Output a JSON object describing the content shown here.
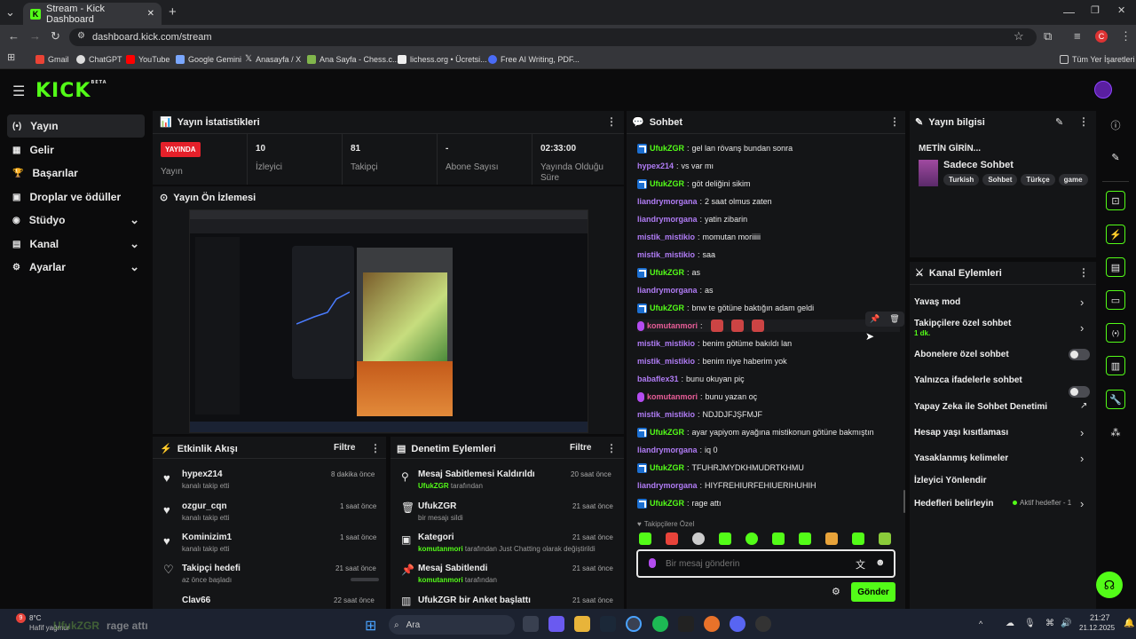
{
  "browser": {
    "tab_title": "Stream - Kick Dashboard",
    "url": "dashboard.kick.com/stream",
    "profile_initial": "C",
    "bookmarks": [
      "Gmail",
      "ChatGPT",
      "YouTube",
      "Google Gemini",
      "Anasayfa / X",
      "Ana Sayfa - Chess.c...",
      "lichess.org • Ücretsi...",
      "Free AI Writing, PDF..."
    ],
    "all_bookmarks": "Tüm Yer İşaretleri"
  },
  "app": {
    "logo": "KICK",
    "logo_sup": "BETA"
  },
  "nav": [
    {
      "label": "Yayın",
      "icon": "(•)"
    },
    {
      "label": "Gelir",
      "icon": "▦"
    },
    {
      "label": "Başarılar",
      "icon": "🏆"
    },
    {
      "label": "Droplar ve ödüller",
      "icon": "▣"
    },
    {
      "label": "Stüdyo",
      "icon": "◉"
    },
    {
      "label": "Kanal",
      "icon": "▤"
    },
    {
      "label": "Ayarlar",
      "icon": "⚙"
    }
  ],
  "stats": {
    "title": "Yayın İstatistikleri",
    "live_badge": "YAYINDA",
    "live_label": "Yayın",
    "items": [
      {
        "value": "10",
        "label": "İzleyici"
      },
      {
        "value": "81",
        "label": "Takipçi"
      },
      {
        "value": "-",
        "label": "Abone Sayısı"
      },
      {
        "value": "02:33:00",
        "label": "Yayında Olduğu Süre"
      }
    ]
  },
  "preview": {
    "title": "Yayın Ön İzlemesi"
  },
  "activity": {
    "title": "Etkinlik Akışı",
    "filter": "Filtre",
    "items": [
      {
        "name": "hypex214",
        "sub": "kanalı takip etti",
        "time": "8 dakika önce"
      },
      {
        "name": "ozgur_cqn",
        "sub": "kanalı takip etti",
        "time": "1 saat önce"
      },
      {
        "name": "Kominizim1",
        "sub": "kanalı takip etti",
        "time": "1 saat önce"
      },
      {
        "name": "Takipçi hedefi",
        "sub": "az önce başladı",
        "time": "21 saat önce"
      },
      {
        "name": "Clav66",
        "sub": "",
        "time": "22 saat önce"
      }
    ]
  },
  "moderation": {
    "title": "Denetim Eylemleri",
    "filter": "Filtre",
    "items": [
      {
        "title": "Mesaj Sabitlemesi Kaldırıldı",
        "user": "UfukZGR",
        "rest": "tarafından",
        "time": "20 saat önce"
      },
      {
        "title": "UfukZGR",
        "user": "",
        "rest": "bir mesajı sildi",
        "time": "21 saat önce"
      },
      {
        "title": "Kategori",
        "user": "komutanmori",
        "rest": "tarafından Just Chatting olarak değiştirildi",
        "time": "21 saat önce"
      },
      {
        "title": "Mesaj Sabitlendi",
        "user": "komutanmori",
        "rest": "tarafından",
        "time": "21 saat önce"
      },
      {
        "title": "UfukZGR bir Anket başlattı",
        "user": "",
        "rest": "",
        "time": "21 saat önce"
      }
    ]
  },
  "chat": {
    "title": "Sohbet",
    "followers_only": "Takipçilere Özel",
    "placeholder": "Bir mesaj gönderin",
    "send": "Gönder",
    "messages": [
      {
        "user": "UfukZGR",
        "color": "green",
        "badge": true,
        "text": "gel lan rövanş bundan sonra"
      },
      {
        "user": "hypex214",
        "color": "purple",
        "text": "vs var mı"
      },
      {
        "user": "UfukZGR",
        "color": "green",
        "badge": true,
        "text": "göt deliğini sikim"
      },
      {
        "user": "liandrymorgana",
        "color": "purple",
        "text": "2 saat olmus zaten"
      },
      {
        "user": "liandrymorgana",
        "color": "purple",
        "text": "yatin zibarin"
      },
      {
        "user": "mistik_mistikio",
        "color": "purple",
        "text": "momutan moriiiii"
      },
      {
        "user": "mistik_mistikio",
        "color": "purple",
        "text": "saa"
      },
      {
        "user": "UfukZGR",
        "color": "green",
        "badge": true,
        "text": "as"
      },
      {
        "user": "liandrymorgana",
        "color": "purple",
        "text": "as"
      },
      {
        "user": "UfukZGR",
        "color": "green",
        "badge": true,
        "text": "bnw te götüne baktığın adam geldi"
      },
      {
        "user": "komutanmori",
        "color": "pink",
        "mic": true,
        "text": ""
      },
      {
        "user": "mistik_mistikio",
        "color": "purple",
        "text": "benim götüme bakıldı lan"
      },
      {
        "user": "mistik_mistikio",
        "color": "purple",
        "text": "benim niye haberim yok"
      },
      {
        "user": "babaflex31",
        "color": "purple",
        "text": "bunu okuyan piç"
      },
      {
        "user": "komutanmori",
        "color": "pink",
        "mic": true,
        "text": "bunu yazan oç"
      },
      {
        "user": "mistik_mistikio",
        "color": "purple",
        "text": "NDJDJFJŞFMJF"
      },
      {
        "user": "UfukZGR",
        "color": "green",
        "badge": true,
        "text": "ayar yapiyom ayağına mistikonun götüne bakmıştın"
      },
      {
        "user": "liandrymorgana",
        "color": "purple",
        "text": "iq 0"
      },
      {
        "user": "UfukZGR",
        "color": "green",
        "badge": true,
        "text": "TFUHRJMYDKHMUDRTKHMU"
      },
      {
        "user": "liandrymorgana",
        "color": "purple",
        "text": "HIYFREHIURFEHIUERIHUHIH"
      },
      {
        "user": "UfukZGR",
        "color": "green",
        "badge": true,
        "text": "rage attı"
      }
    ]
  },
  "info": {
    "title": "Yayın bilgisi",
    "stream_title": "METİN GİRİN...",
    "category": "Sadece Sohbet",
    "tags": [
      "Turkish",
      "Sohbet",
      "Türkçe",
      "game"
    ]
  },
  "actions": {
    "title": "Kanal Eylemleri",
    "items": [
      {
        "label": "Yavaş mod",
        "sub": "",
        "type": "chevron"
      },
      {
        "label": "Takipçilere özel sohbet",
        "sub": "1 dk.",
        "type": "chevron"
      },
      {
        "label": "Abonelere özel sohbet",
        "sub": "",
        "type": "toggle"
      },
      {
        "label": "Yalnızca ifadelerle sohbet",
        "sub": "",
        "type": "toggle"
      },
      {
        "label": "Yapay Zeka ile Sohbet Denetimi",
        "sub": "",
        "type": "ext"
      },
      {
        "label": "Hesap yaşı kısıtlaması",
        "sub": "",
        "type": "chevron"
      },
      {
        "label": "Yasaklanmış kelimeler",
        "sub": "",
        "type": "chevron"
      },
      {
        "label": "İzleyici Yönlendir",
        "sub": "",
        "type": "none"
      },
      {
        "label": "Hedefleri belirleyin",
        "sub": "",
        "type": "chevron"
      }
    ],
    "goals_status": "Aktif hedefler - 1"
  },
  "taskbar": {
    "temp": "8°C",
    "weather": "Hafif yağmur",
    "ticker": "rage attı",
    "ticker_user": "UfukZGR",
    "search": "Ara",
    "time": "21:27",
    "date": "21.12.2025",
    "notif": "9"
  }
}
